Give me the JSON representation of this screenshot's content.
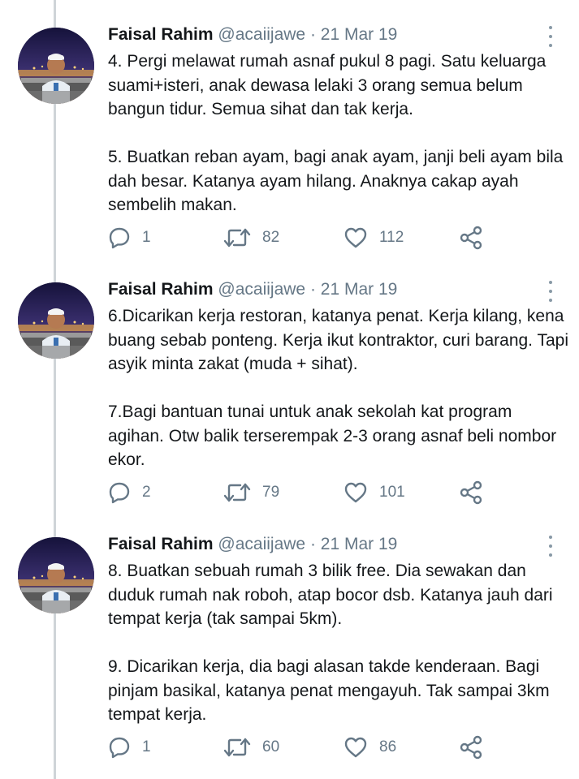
{
  "colors": {
    "muted": "#657786",
    "thread_line": "#cfd4d8",
    "icon": "#657786"
  },
  "tweets": [
    {
      "author": "Faisal Rahim",
      "handle": "@acaiijawe",
      "separator": "·",
      "date": "21 Mar 19",
      "paragraphs": [
        "4. Pergi melawat rumah asnaf pukul 8 pagi. Satu keluarga suami+isteri, anak dewasa lelaki 3 orang semua belum bangun tidur. Semua sihat dan tak kerja.",
        "5. Buatkan reban ayam, bagi anak ayam, janji beli ayam bila dah besar. Katanya ayam hilang. Anaknya cakap ayah sembelih makan."
      ],
      "replies": "1",
      "retweets": "82",
      "likes": "112"
    },
    {
      "author": "Faisal Rahim",
      "handle": "@acaiijawe",
      "separator": "·",
      "date": "21 Mar 19",
      "paragraphs": [
        "6.Dicarikan kerja restoran, katanya penat. Kerja kilang, kena buang sebab ponteng. Kerja ikut kontraktor, curi barang. Tapi asyik minta zakat (muda + sihat).",
        "7.Bagi bantuan tunai untuk anak sekolah kat program agihan. Otw balik terserempak 2-3 orang asnaf beli nombor ekor."
      ],
      "replies": "2",
      "retweets": "79",
      "likes": "101"
    },
    {
      "author": "Faisal Rahim",
      "handle": "@acaiijawe",
      "separator": "·",
      "date": "21 Mar 19",
      "paragraphs": [
        "8. Buatkan sebuah rumah 3 bilik free. Dia sewakan dan duduk rumah nak roboh, atap bocor dsb. Katanya jauh dari tempat kerja (tak sampai 5km).",
        "9. Dicarikan kerja, dia bagi alasan takde kenderaan. Bagi pinjam basikal, katanya penat mengayuh. Tak sampai 3km tempat kerja."
      ],
      "replies": "1",
      "retweets": "60",
      "likes": "86"
    }
  ]
}
